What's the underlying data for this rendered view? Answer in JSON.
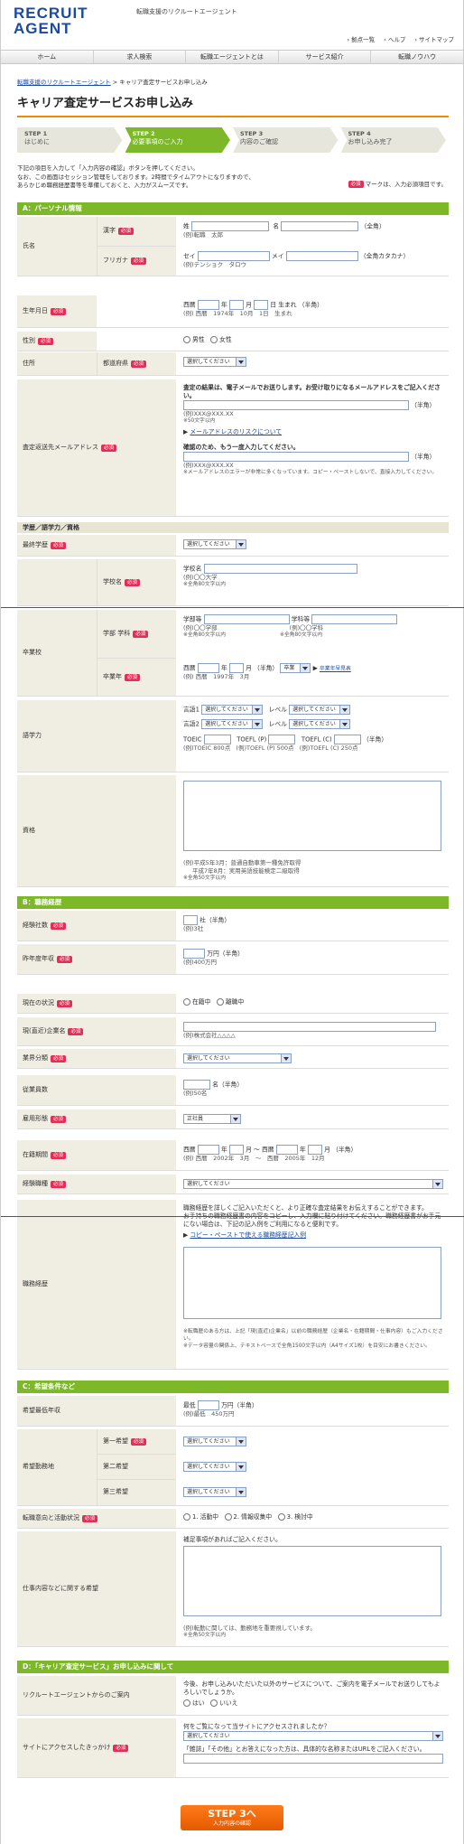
{
  "header": {
    "logo1": "RECRUIT",
    "logo2": "AGENT",
    "tagline": "転職支援のリクルートエージェント",
    "util": [
      "拠点一覧",
      "ヘルプ",
      "サイトマップ"
    ]
  },
  "gnav": [
    "ホーム",
    "求人検索",
    "転職エージェントとは",
    "サービス紹介",
    "転職ノウハウ"
  ],
  "breadcrumb": {
    "home": "転職支援のリクルートエージェント",
    "current": "キャリア査定サービスお申し込み"
  },
  "title": "キャリア査定サービスお申し込み",
  "steps": [
    {
      "n": "STEP 1",
      "l": "はじめに"
    },
    {
      "n": "STEP 2",
      "l": "必要事項のご入力"
    },
    {
      "n": "STEP 3",
      "l": "内容のご確認"
    },
    {
      "n": "STEP 4",
      "l": "お申し込み完了"
    }
  ],
  "intro": [
    "下記の項目を入力して「入力内容の確認」ボタンを押してください。",
    "なお、この画面はセッション管理をしております。2時間でタイムアウトになりますので、",
    "あらかじめ職務経歴書等を準備しておくと、入力がスムーズです。"
  ],
  "req_label": "必須",
  "req_note": "マークは、入力必須項目です。",
  "secA": "A：パーソナル情報",
  "name": {
    "label": "氏名",
    "kanji": "漢字",
    "sei": "姓",
    "mei": "名",
    "zen": "（全角）",
    "kanji_ex": "(例)転職　太郎",
    "furi": "フリガナ",
    "furi_sei": "セイ",
    "furi_mei": "メイ",
    "furi_zen": "（全角カタカナ）",
    "furi_ex": "(例)テンショク　タロウ"
  },
  "birth": {
    "label": "生年月日",
    "seireki": "西暦",
    "nen": "年",
    "gatsu": "月",
    "nichi": "日",
    "umare": "生まれ",
    "han": "（半角）",
    "ex": "(例) 西暦　1974年　10月　1日　生まれ"
  },
  "gender": {
    "label": "性別",
    "male": "男性",
    "female": "女性"
  },
  "address": {
    "label": "住所",
    "pref": "都道府県",
    "select": "選択してください"
  },
  "email": {
    "label": "査定返送先メールアドレス",
    "note1": "査定の結果は、電子メールでお送りします。お受け取りになるメールアドレスをご記入ください。",
    "han": "（半角）",
    "ex": "(例)XXX@XXX.XX",
    "lim": "※50文字以内",
    "link": "メールアドレスのリスクについて",
    "confirm": "確認のため、もう一度入力してください。",
    "ex2": "(例)XXX@XXX.XX",
    "warn": "※メールアドレスのエラーが非常に多くなっています。コピー・ペーストしないで、直接入力してください。"
  },
  "edu_head": "学歴／語学力／資格",
  "final_edu": {
    "label": "最終学歴",
    "select": "選択してください"
  },
  "school": {
    "label": "学校名",
    "ph": "学校名",
    "ex": "(例)〇〇大学",
    "lim": "※全角80文字以内"
  },
  "grad": {
    "label": "卒業校",
    "dept": "学部 学科",
    "gakubu": "学部等",
    "gakka": "学科等",
    "ex1": "(例)〇〇学部",
    "ex2": "(例)〇〇学科",
    "lim": "※全角80文字以内",
    "year_label": "卒業年",
    "seireki": "西暦",
    "nen": "年",
    "gatsu": "月",
    "han": "（半角）",
    "sotsu": "卒業",
    "link": "卒業年早見表",
    "ex": "(例) 西暦　1997年　3月"
  },
  "lang": {
    "label": "語学力",
    "l1": "言語1",
    "l2": "言語2",
    "level": "レベル",
    "select": "選択してください",
    "toeic": "TOEIC",
    "toeflp": "TOEFL (P)",
    "toeflc": "TOEFL (C)",
    "han": "（半角）",
    "ex1": "(例)TOEIC 800点",
    "ex2": "(例)TOEFL (P) 500点",
    "ex3": "(例)TOEFL (C) 250点"
  },
  "cert": {
    "label": "資格",
    "ex1": "(例)平成5年3月：普通自動車第一種免許取得",
    "ex2": "平成7年8月：実用英語技能検定二級取得",
    "lim": "※全角50文字以内"
  },
  "secB": "B：職務経歴",
  "companies": {
    "label": "経験社数",
    "sha": "社（半角）",
    "ex": "(例)3社"
  },
  "income": {
    "label": "昨年度年収",
    "man": "万円（半角）",
    "ex": "(例)400万円"
  },
  "status": {
    "label": "現在の状況",
    "on": "在籍中",
    "off": "離職中"
  },
  "company": {
    "label": "現(直近)企業名",
    "ex": "(例)株式会社△△△△"
  },
  "industry": {
    "label": "業界分類",
    "select": "選択してください"
  },
  "employees": {
    "label": "従業員数",
    "mei": "名（半角）",
    "ex": "(例)50名"
  },
  "emptype": {
    "label": "雇用形態",
    "value": "正社員"
  },
  "tenure": {
    "label": "在籍期間",
    "seireki": "西暦",
    "nen": "年",
    "gatsu": "月",
    "kara": "～",
    "han": "（半角）",
    "ex": "(例) 西暦　2002年　3月　～　西暦　2005年　12月"
  },
  "jobtype": {
    "label": "経験職種",
    "select": "選択してください"
  },
  "history": {
    "label": "職務経歴",
    "note1": "職務経歴を詳しくご記入いただくと、より正確な査定結果をお伝えすることができます。",
    "note2": "お手持ちの職務経歴書の内容をコピーし、入力欄に貼り付けてください。職務経歴書がお手元にない場合は、下記の記入例をご利用になると便利です。",
    "link": "コピー・ペーストで使える職務経歴記入例",
    "n1": "※転職歴のある方は、上記「現(直近)企業名」以前の職務経歴（企業名・在籍期間・仕事内容）もご入力ください。",
    "n2": "※データ容量の関係上、テキストベースで全角1500文字以内（A4サイズ1枚）を目安にお書きください。"
  },
  "secC": "C：希望条件など",
  "desired_income": {
    "label": "希望最低年収",
    "min": "最低",
    "man": "万円（半角）",
    "ex": "(例)最低　450万円"
  },
  "location": {
    "label": "希望勤務地",
    "c1": "第一希望",
    "c2": "第二希望",
    "c3": "第三希望",
    "select": "選択してください"
  },
  "timing": {
    "label": "転職意向と活動状況",
    "o1": "1. 活動中",
    "o2": "2. 情報収集中",
    "o3": "3. 検討中"
  },
  "wish": {
    "label": "仕事内容などに関する希望",
    "ph": "補足事項があればご記入ください。",
    "ex": "(例)転勤に関しては、勤務地を重要視しています。",
    "lim": "※全角50文字以内"
  },
  "secD": "D：「キャリア査定サービス」お申し込みに関して",
  "guide": {
    "label": "リクルートエージェントからのご案内",
    "text": "今後、お申し込みいただいた以外のサービスについて、ご案内を電子メールでお送りしてもよろしいでしょうか。",
    "yes": "はい",
    "no": "いいえ"
  },
  "trigger": {
    "label": "サイトにアクセスしたきっかけ",
    "q": "何をご覧になって当サイトにアクセスされましたか？",
    "select": "選択してください",
    "note": "「雑誌」「その他」とお答えになった方は、具体的な名称またはURLをご記入ください。"
  },
  "submit": {
    "main": "STEP 3へ",
    "sub": "入力内容の確認"
  }
}
